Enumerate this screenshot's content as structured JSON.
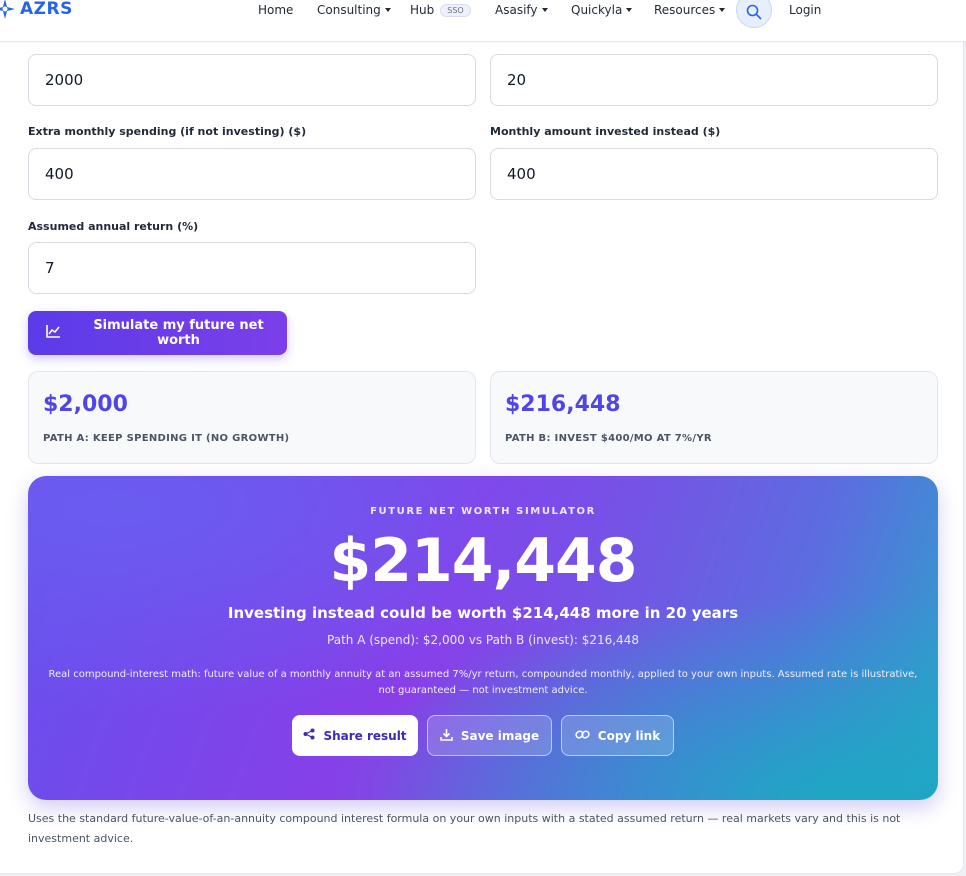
{
  "header": {
    "brand": "AZRS",
    "nav": [
      {
        "label": "Home"
      },
      {
        "label": "Consulting"
      },
      {
        "label": "Hub",
        "badge": "SSO"
      },
      {
        "label": "Asasify"
      },
      {
        "label": "Quickyla"
      },
      {
        "label": "Resources"
      }
    ],
    "search_icon": "search-icon",
    "login_label": "Login"
  },
  "form": {
    "field1_value": "2000",
    "field2_value": "20",
    "extra_spending_label": "Extra monthly spending (if not investing) ($)",
    "extra_spending_value": "400",
    "monthly_invested_label": "Monthly amount invested instead ($)",
    "monthly_invested_value": "400",
    "annual_return_label": "Assumed annual return (%)",
    "annual_return_value": "7",
    "simulate_label": "Simulate my future net worth"
  },
  "stats": {
    "path_a_value": "$2,000",
    "path_a_label": "PATH A: KEEP SPENDING IT (NO GROWTH)",
    "path_b_value": "$216,448",
    "path_b_label": "PATH B: INVEST $400/MO AT 7%/YR"
  },
  "result": {
    "kicker": "FUTURE NET WORTH SIMULATOR",
    "amount": "$214,448",
    "headline": "Investing instead could be worth $214,448 more in 20 years",
    "subline": "Path A (spend): $2,000 vs Path B (invest): $216,448",
    "note": "Real compound-interest math: future value of a monthly annuity at an assumed 7%/yr return, compounded monthly, applied to your own inputs. Assumed rate is illustrative, not guaranteed — not investment advice.",
    "share_label": "Share result",
    "save_label": "Save image",
    "copy_label": "Copy link"
  },
  "disclaimer": "Uses the standard future-value-of-an-annuity compound interest formula on your own inputs with a stated assumed return — real markets vary and this is not investment advice.",
  "colors": {
    "accent": "#4f46e5",
    "brand": "#2563eb",
    "gradient_start": "#6650ee",
    "gradient_end": "#2aa6c8"
  }
}
